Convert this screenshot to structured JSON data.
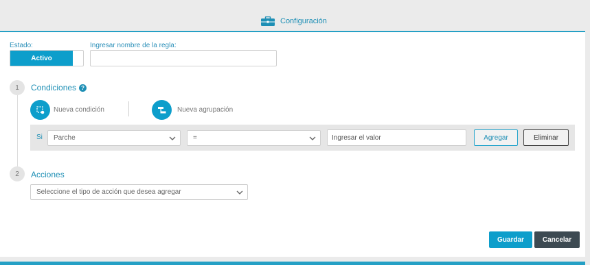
{
  "header": {
    "title": "Configuración",
    "icon": "briefcase-icon"
  },
  "form": {
    "estado_label": "Estado:",
    "estado_value": "Activo",
    "rule_name_label": "Ingresar nombre de la regla:",
    "rule_name_value": ""
  },
  "conditions": {
    "step": "1",
    "title": "Condiciones",
    "new_condition": "Nueva condición",
    "new_group": "Nueva agrupación",
    "row": {
      "prefix": "Si",
      "field": "Parche",
      "operator": "=",
      "value_placeholder": "Ingresar el valor",
      "add_label": "Agregar",
      "remove_label": "Eliminar"
    }
  },
  "actions": {
    "step": "2",
    "title": "Acciones",
    "select_placeholder": "Seleccione el tipo de acción que desea agregar"
  },
  "footer": {
    "save_label": "Guardar",
    "cancel_label": "Cancelar"
  },
  "colors": {
    "accent": "#0d9ecb",
    "dark": "#3d4a52",
    "header_bg": "#ebebeb"
  }
}
